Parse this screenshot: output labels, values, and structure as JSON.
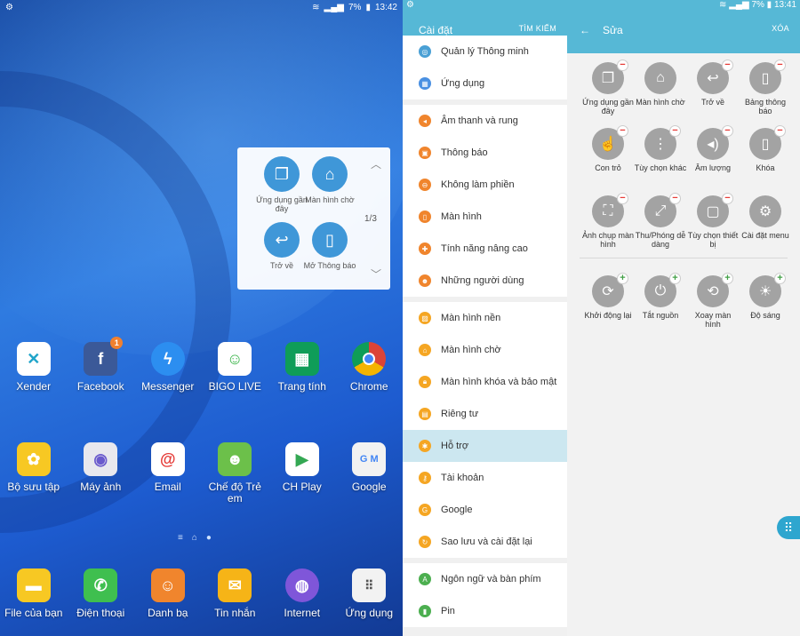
{
  "status_left": {
    "time": "13:42",
    "battery": "7%"
  },
  "status_right": {
    "time": "13:41",
    "battery": "7%"
  },
  "float_panel": {
    "items": [
      {
        "label": "Ứng dụng gần đây",
        "icon": "recent-apps-icon"
      },
      {
        "label": "Màn hình chờ",
        "icon": "home-icon"
      },
      {
        "label": "Trở về",
        "icon": "back-icon"
      },
      {
        "label": "Mở Thông báo",
        "icon": "notification-panel-icon"
      }
    ],
    "page": "1/3"
  },
  "apps": {
    "row1": [
      {
        "label": "Xender",
        "color": "#ffffff"
      },
      {
        "label": "Facebook",
        "color": "#3b5998",
        "badge": "1"
      },
      {
        "label": "Messenger",
        "color": "#2c8ef0"
      },
      {
        "label": "BIGO LIVE",
        "color": "#ffffff"
      },
      {
        "label": "Trang tính",
        "color": "#0f9d58"
      },
      {
        "label": "Chrome",
        "color": "#db4437"
      }
    ],
    "row2": [
      {
        "label": "Bộ sưu tập",
        "color": "#f7c823"
      },
      {
        "label": "Máy ảnh",
        "color": "#e8e8ee"
      },
      {
        "label": "Email",
        "color": "#ffffff"
      },
      {
        "label": "Chế độ Trẻ em",
        "color": "#6cc04a"
      },
      {
        "label": "CH Play",
        "color": "#ffffff"
      },
      {
        "label": "Google",
        "color": "#f2f2f2"
      }
    ],
    "dock": [
      {
        "label": "File của bạn",
        "color": "#f7c823"
      },
      {
        "label": "Điện thoại",
        "color": "#3fbf4f"
      },
      {
        "label": "Danh bạ",
        "color": "#f0852d"
      },
      {
        "label": "Tin nhắn",
        "color": "#f6b417"
      },
      {
        "label": "Internet",
        "color": "#7f56d9"
      },
      {
        "label": "Ứng dụng",
        "color": "#f2f2f2"
      }
    ]
  },
  "settings": {
    "title": "Cài đặt",
    "search": "TÌM KIẾM",
    "items": [
      {
        "label": "Quản lý Thông minh",
        "color": "#4aa0d5"
      },
      {
        "label": "Ứng dụng",
        "color": "#4a90e2"
      },
      {
        "label": "Âm thanh và rung",
        "color": "#f0852d"
      },
      {
        "label": "Thông báo",
        "color": "#f0852d"
      },
      {
        "label": "Không làm phiền",
        "color": "#f0852d"
      },
      {
        "label": "Màn hình",
        "color": "#f0852d"
      },
      {
        "label": "Tính năng nâng cao",
        "color": "#f0852d"
      },
      {
        "label": "Những người dùng",
        "color": "#f0852d"
      },
      {
        "label": "Màn hình nền",
        "color": "#f5a623"
      },
      {
        "label": "Màn hình chờ",
        "color": "#f5a623"
      },
      {
        "label": "Màn hình khóa và bảo mật",
        "color": "#f5a623"
      },
      {
        "label": "Riêng tư",
        "color": "#f5a623"
      },
      {
        "label": "Hỗ trợ",
        "color": "#f5a623"
      },
      {
        "label": "Tài khoản",
        "color": "#f5a623"
      },
      {
        "label": "Google",
        "color": "#f5a623"
      },
      {
        "label": "Sao lưu và cài đặt lại",
        "color": "#f5a623"
      },
      {
        "label": "Ngôn ngữ và bàn phím",
        "color": "#4caf50"
      },
      {
        "label": "Pin",
        "color": "#4caf50"
      }
    ]
  },
  "edit": {
    "title": "Sửa",
    "action": "XÓA",
    "active": [
      {
        "label": "Ứng dụng gần đây",
        "icon": "recent-apps-icon"
      },
      {
        "label": "Màn hình chờ",
        "icon": "home-icon"
      },
      {
        "label": "Trở về",
        "icon": "back-icon"
      },
      {
        "label": "Bảng thông báo",
        "icon": "notification-panel-icon"
      },
      {
        "label": "Con trỏ",
        "icon": "cursor-icon"
      },
      {
        "label": "Tùy chọn khác",
        "icon": "more-options-icon"
      },
      {
        "label": "Âm lượng",
        "icon": "volume-icon"
      },
      {
        "label": "Khóa",
        "icon": "lock-phone-icon"
      },
      {
        "label": "Ảnh chụp màn hình",
        "icon": "screenshot-icon"
      },
      {
        "label": "Thu/Phóng dễ dàng",
        "icon": "zoom-icon"
      },
      {
        "label": "Tùy chọn thiết bị",
        "icon": "device-options-icon"
      },
      {
        "label": "Cài đặt menu",
        "icon": "gear-icon"
      }
    ],
    "available": [
      {
        "label": "Khởi động lại",
        "icon": "restart-icon"
      },
      {
        "label": "Tắt nguồn",
        "icon": "power-icon"
      },
      {
        "label": "Xoay màn hình",
        "icon": "rotate-icon"
      },
      {
        "label": "Độ sáng",
        "icon": "brightness-icon"
      }
    ]
  }
}
